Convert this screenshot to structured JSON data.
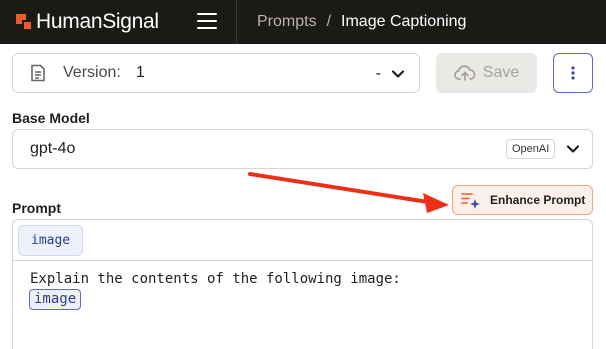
{
  "topbar": {
    "brand": "HumanSignal",
    "breadcrumbs": [
      "Prompts",
      "Image Captioning"
    ],
    "separator": "/"
  },
  "version": {
    "label": "Version:",
    "value": "1",
    "extra": "-",
    "icon": "document-icon"
  },
  "toolbar": {
    "save_label": "Save",
    "more_icon": "more-vertical-icon"
  },
  "base_model": {
    "label": "Base Model",
    "value": "gpt-4o",
    "provider": "OpenAI"
  },
  "prompt": {
    "label": "Prompt",
    "enhance_label": "Enhance Prompt",
    "variables": [
      "image"
    ],
    "text": "Explain the contents of the following image:",
    "inline_variable": "image"
  },
  "colors": {
    "topbar_bg": "#1c1a17",
    "brand_accent": "#f05a28",
    "annotation_arrow": "#ee2e17",
    "primary": "#5b6ad0"
  }
}
